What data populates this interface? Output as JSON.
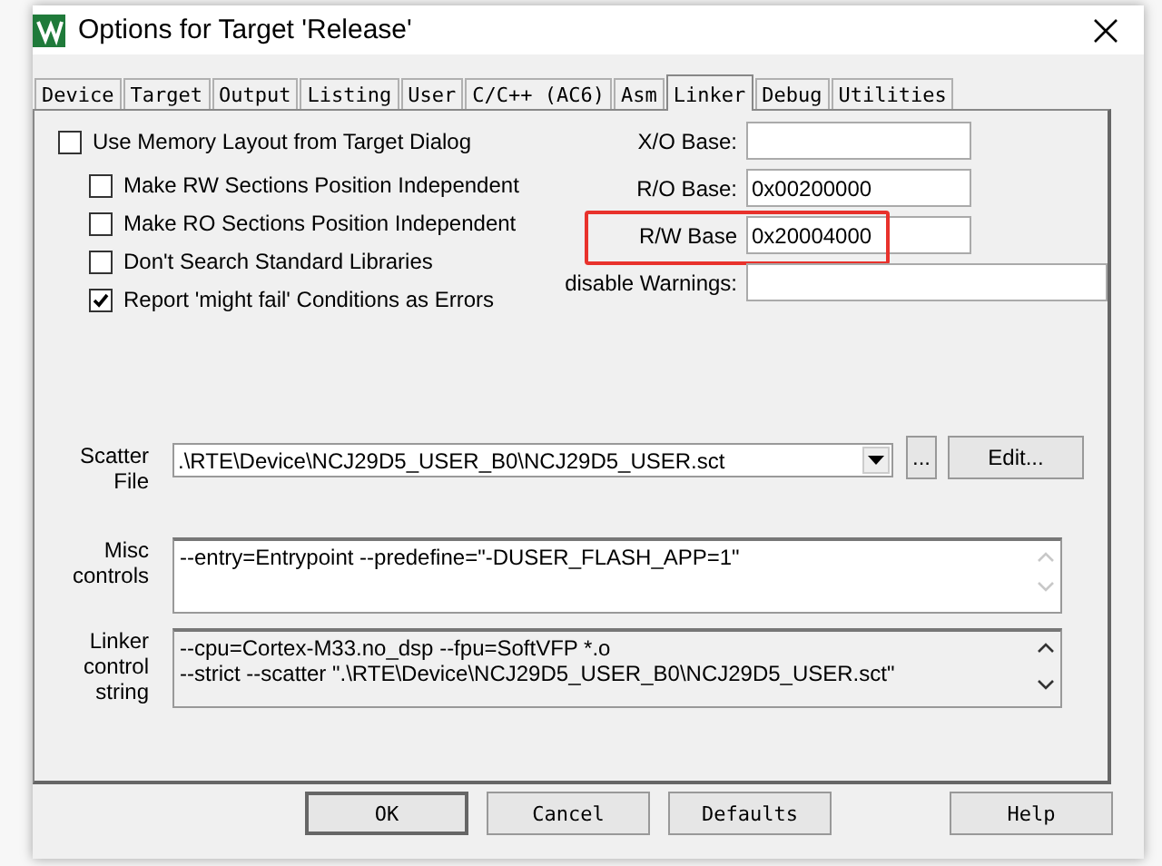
{
  "window": {
    "title": "Options for Target 'Release'"
  },
  "tabs": [
    {
      "label": "Device",
      "selected": false
    },
    {
      "label": "Target",
      "selected": false
    },
    {
      "label": "Output",
      "selected": false
    },
    {
      "label": "Listing",
      "selected": false
    },
    {
      "label": "User",
      "selected": false
    },
    {
      "label": "C/C++ (AC6)",
      "selected": false
    },
    {
      "label": "Asm",
      "selected": false
    },
    {
      "label": "Linker",
      "selected": true
    },
    {
      "label": "Debug",
      "selected": false
    },
    {
      "label": "Utilities",
      "selected": false
    }
  ],
  "options": [
    {
      "label": "Use Memory Layout from Target Dialog",
      "checked": false,
      "children": [
        {
          "label": "Make RW Sections Position Independent",
          "checked": false
        },
        {
          "label": "Make RO Sections Position Independent",
          "checked": false
        },
        {
          "label": "Don't Search Standard Libraries",
          "checked": false
        },
        {
          "label": "Report 'might fail' Conditions as Errors",
          "checked": true
        }
      ]
    }
  ],
  "address_fields": [
    {
      "label": "X/O Base:",
      "kind": "short",
      "highlighted": false
    },
    {
      "label": "R/O Base:",
      "value": "0x00200000",
      "kind": "short",
      "highlighted": false
    },
    {
      "label": "R/W Base",
      "value": "0x20004000",
      "kind": "short",
      "highlighted": true
    },
    {
      "label": "disable Warnings:",
      "kind": "wide",
      "highlighted": false
    }
  ],
  "scatter_file": {
    "label": "Scatter File",
    "value": ".\\RTE\\Device\\NCJ29D5_USER_B0\\NCJ29D5_USER.sct",
    "browse_button": "...",
    "edit_button": "Edit..."
  },
  "misc_controls": {
    "label": "Misc controls",
    "value": "--entry=Entrypoint --predefine=\"-DUSER_FLASH_APP=1\""
  },
  "linker_control_string": {
    "label": "Linker control string",
    "lines": [
      "--cpu=Cortex-M33.no_dsp --fpu=SoftVFP *.o",
      "--strict --scatter \".\\RTE\\Device\\NCJ29D5_USER_B0\\NCJ29D5_USER.sct\""
    ]
  },
  "buttons": [
    {
      "label": "OK",
      "default": true
    },
    {
      "label": "Cancel",
      "default": false
    },
    {
      "label": "Defaults",
      "default": false
    },
    {
      "label": "Help",
      "default": false
    }
  ]
}
